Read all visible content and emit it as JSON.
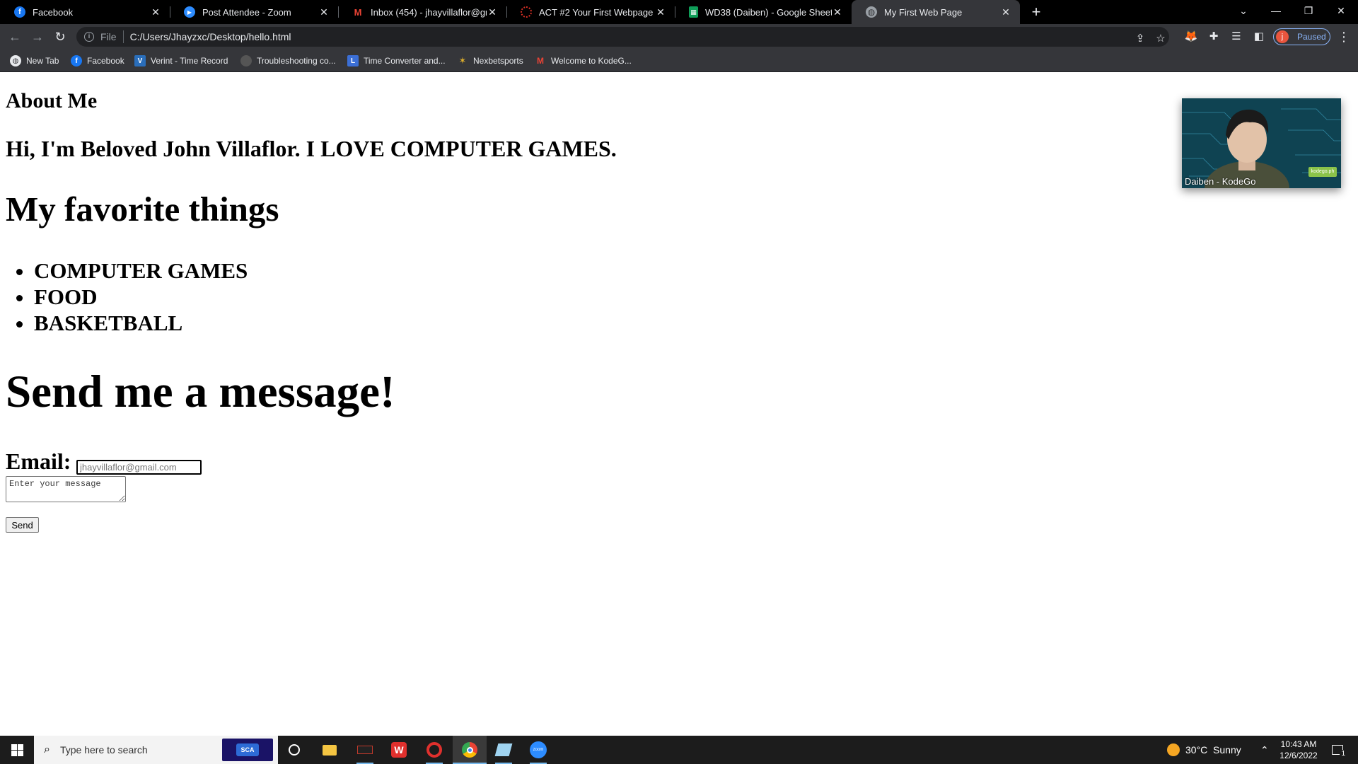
{
  "browser": {
    "tabs": [
      {
        "title": "Facebook",
        "icon": "facebook-icon",
        "color": "#1877f2",
        "glyph": "f"
      },
      {
        "title": "Post Attendee - Zoom",
        "icon": "zoom-icon",
        "color": "#2d8cff",
        "glyph": "▶"
      },
      {
        "title": "Inbox (454) - jhayvillaflor@gmail",
        "icon": "gmail-icon",
        "color": "#ea4335",
        "glyph": "M"
      },
      {
        "title": "ACT #2 Your First Webpage",
        "icon": "loading-spinner-icon",
        "color": "#d93025",
        "glyph": "◌"
      },
      {
        "title": "WD38 (Daiben) - Google Sheets",
        "icon": "google-sheets-icon",
        "color": "#0f9d58",
        "glyph": "▦"
      },
      {
        "title": "My First Web Page",
        "icon": "globe-icon",
        "color": "#9aa0a6",
        "glyph": "◍"
      }
    ],
    "address": {
      "scheme": "File",
      "url": "C:/Users/Jhayzxc/Desktop/hello.html"
    },
    "profile_status": "Paused",
    "profile_initial": "j",
    "bookmarks": [
      {
        "label": "New Tab",
        "icon": "globe-icon",
        "color": "#e8eaed",
        "glyph": "◍"
      },
      {
        "label": "Facebook",
        "icon": "facebook-icon",
        "color": "#1877f2",
        "glyph": "f"
      },
      {
        "label": "Verint - Time Record",
        "icon": "verint-icon",
        "color": "#2a6ebb",
        "glyph": "V"
      },
      {
        "label": "Troubleshooting co...",
        "icon": "troubleshooting-icon",
        "color": "#555555",
        "glyph": "●"
      },
      {
        "label": "Time Converter and...",
        "icon": "time-converter-icon",
        "color": "#3b6fd6",
        "glyph": "L"
      },
      {
        "label": "Nexbetsports",
        "icon": "nexbetsports-icon",
        "color": "#e1b12c",
        "glyph": "✶"
      },
      {
        "label": "Welcome to KodeG...",
        "icon": "gmail-icon",
        "color": "#ea4335",
        "glyph": "M"
      }
    ]
  },
  "page": {
    "about_heading": "About Me",
    "intro": "Hi, I'm Beloved John Villaflor. I LOVE COMPUTER GAMES.",
    "favorites_heading": "My favorite things",
    "favorites": [
      "COMPUTER GAMES",
      "FOOD",
      "BASKETBALL"
    ],
    "message_heading": "Send me a message!",
    "email_label": "Email:",
    "email_placeholder": "jhayvillaflor@gmail.com",
    "message_placeholder": "Enter your message",
    "send_label": "Send"
  },
  "zoom_video": {
    "participant": "Daiben - KodeGo",
    "badge": "kodego.ph"
  },
  "taskbar": {
    "search_placeholder": "Type here to search",
    "search_badge": "SCA",
    "weather": "30°C  Sunny",
    "time": "10:43 AM",
    "date": "12/6/2022",
    "notification_count": "1"
  }
}
